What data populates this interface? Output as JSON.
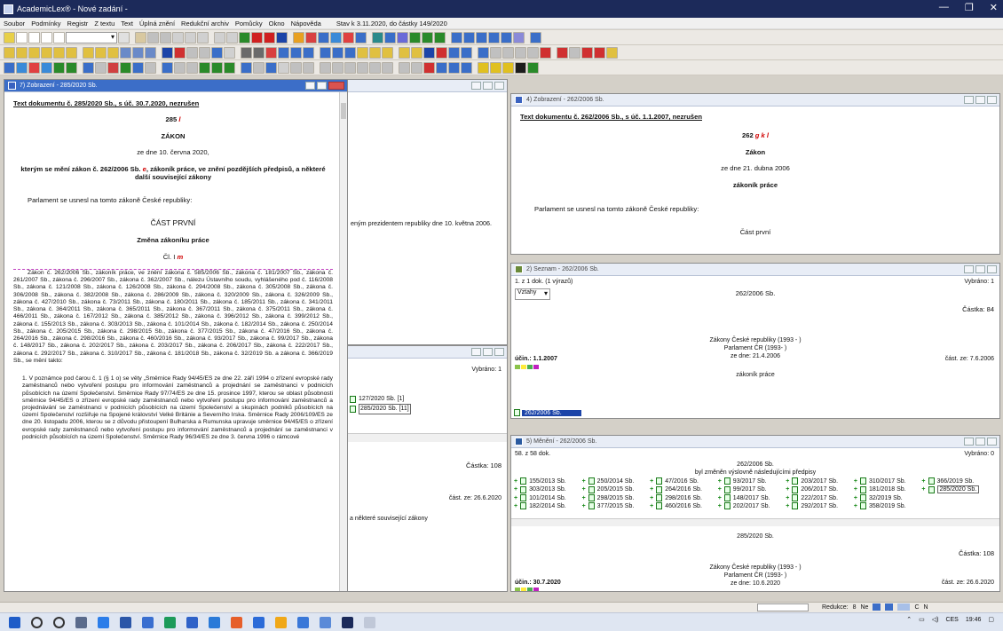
{
  "window": {
    "title": "AcademicLex® - Nové zadání -"
  },
  "menu": {
    "items": [
      "Soubor",
      "Podmínky",
      "Registr",
      "Z textu",
      "Text",
      "Úplná znění",
      "Redukční archiv",
      "Pomůcky",
      "Okno",
      "Nápověda"
    ],
    "status": "Stav k 3.11.2020, do částky 149/2020"
  },
  "win_left": {
    "title": "7) Zobrazení - 285/2020 Sb.",
    "heading": "Text dokumentu č. 285/2020 Sb., s úč. 30.7.2020, nezrušen",
    "number": "285",
    "number_suffix": "l",
    "type": "ZÁKON",
    "date": "ze dne 10. června 2020,",
    "subject_line1": "kterým se mění zákon č. 262/2006 Sb.",
    "subject_mark": "e",
    "subject_line2": ", zákoník práce, ve znění pozdějších předpisů, a některé",
    "subject_line3": "další související zákony",
    "preamble": "Parlament se usnesl na tomto zákoně České republiky:",
    "part": "ČÁST PRVNÍ",
    "part_title": "Změna zákoníku práce",
    "article": "Čl. I",
    "article_mark": "m",
    "para1": "Zákon č. 262/2006 Sb., zákoník práce, ve znění zákona č. 585/2006 Sb., zákona č. 181/2007 Sb., zákona č. 261/2007 Sb., zákona č. 296/2007 Sb., zákona č. 362/2007 Sb., nálezu Ústavního soudu, vyhlášeného pod č. 116/2008 Sb., zákona č. 121/2008 Sb., zákona č. 126/2008 Sb., zákona č. 294/2008 Sb., zákona č. 305/2008 Sb., zákona č. 306/2008 Sb., zákona č. 382/2008 Sb., zákona č. 286/2009 Sb., zákona č. 320/2009 Sb., zákona č. 326/2009 Sb., zákona č. 427/2010 Sb., zákona č. 73/2011 Sb., zákona č. 180/2011 Sb., zákona č. 185/2011 Sb., zákona č. 341/2011 Sb., zákona č. 364/2011 Sb., zákona č. 365/2011 Sb., zákona č. 367/2011 Sb., zákona č. 375/2011 Sb., zákona č. 466/2011 Sb., zákona č. 167/2012 Sb., zákona č. 385/2012 Sb., zákona č. 396/2012 Sb., zákona č. 399/2012 Sb., zákona č. 155/2013 Sb., zákona č. 303/2013 Sb., zákona č. 101/2014 Sb., zákona č. 182/2014 Sb., zákona č. 250/2014 Sb., zákona č. 205/2015 Sb., zákona č. 298/2015 Sb., zákona č. 377/2015 Sb., zákona č. 47/2016 Sb., zákona č. 264/2016 Sb., zákona č. 298/2016 Sb., zákona č. 460/2016 Sb., zákona č. 93/2017 Sb., zákona č. 99/2017 Sb., zákona č. 148/2017 Sb., zákona č. 202/2017 Sb., zákona č. 203/2017 Sb., zákona č. 206/2017 Sb., zákona č. 222/2017 Sb., zákona č. 292/2017 Sb., zákona č. 310/2017 Sb., zákona č. 181/2018 Sb., zákona č. 32/2019 Sb. a zákona č. 366/2019 Sb., se mění takto:",
    "para2": "1. V poznámce pod čarou č. 1 (§ 1 o) se věty „Směrnice Rady 94/45/ES ze dne 22. září 1994 o zřízení evropské rady zaměstnanců nebo vytvoření postupu pro informování zaměstnanců a projednání se zaměstnanci v podnicích působících na území Společenství. Směrnice Rady 97/74/ES ze dne 15. prosince 1997, kterou se oblast působnosti směrnice 94/45/ES o zřízení evropské rady zaměstnanců nebo vytvoření postupu pro informování zaměstnanců a projednávání se zaměstnanci v podnicích působících na území Společenství a skupinách podniků působících na území Společenství rozšiřuje na Spojené království Velké Británie a Severního Irska. Směrnice Rady 2006/109/ES ze dne 20. listopadu 2006, kterou se z důvodu přistoupení Bulharska a Rumunska upravuje směrnice 94/45/ES o zřízení evropské rady zaměstnanců nebo vytvoření postupu pro informování zaměstnanců a projednání se zaměstnanci v podnicích působících na území Společenství. Směrnice Rady 96/34/ES ze dne 3. června 1996 o rámcové"
  },
  "win_mid_top": {
    "text": "eným prezidentem republiky dne 10. května 2006."
  },
  "win_mid_bottom": {
    "selected": "Vybráno: 1",
    "items": [
      "127/2020 Sb. [1]",
      "285/2020 Sb. [11]"
    ],
    "castka": "Částka: 108",
    "cast": "část. ze: 26.6.2020",
    "related": "a některé související zákony"
  },
  "win_right_top": {
    "title": "4) Zobrazení - 262/2006 Sb.",
    "heading": "Text dokumentu č. 262/2006 Sb., s úč. 1.1.2007, nezrušen",
    "number": "262",
    "marks": "g k l",
    "type": "Zákon",
    "date": "ze dne 21. dubna 2006",
    "name": "zákoník práce",
    "preamble": "Parlament se usnesl na tomto zákoně České republiky:",
    "part": "Část první"
  },
  "win_seznam": {
    "title": "2) Seznam - 262/2006 Sb.",
    "count": "1. z 1 dok. (1 výrazů)",
    "selected": "Vybráno: 1",
    "combo": "Vztahy",
    "doc": "262/2006 Sb.",
    "castka": "Částka: 84",
    "issuer1": "Zákony České republiky (1993 -   )",
    "issuer2": "Parlament ČR (1993-   )",
    "ucinnost": "účin.: 1.1.2007",
    "date": "ze dne: 21.4.2006",
    "cast": "část. ze: 7.6.2006",
    "name": "zákoník práce",
    "list_item": "262/2006 Sb."
  },
  "win_meneni": {
    "title": "5) Měnění - 262/2006 Sb.",
    "count": "58. z 58 dok.",
    "selected": "Vybráno: 0",
    "doc": "262/2006 Sb.",
    "subtitle": "byl změněn výslovně následujícími předpisy",
    "grid": [
      "155/2013 Sb.",
      "250/2014 Sb.",
      "47/2016 Sb.",
      "93/2017 Sb.",
      "203/2017 Sb.",
      "310/2017 Sb.",
      "366/2019 Sb.",
      "303/2013 Sb.",
      "205/2015 Sb.",
      "264/2016 Sb.",
      "99/2017 Sb.",
      "206/2017 Sb.",
      "181/2018 Sb.",
      "285/2020 Sb.",
      "101/2014 Sb.",
      "298/2015 Sb.",
      "298/2016 Sb.",
      "148/2017 Sb.",
      "222/2017 Sb.",
      "32/2019 Sb.",
      "",
      "182/2014 Sb.",
      "377/2015 Sb.",
      "460/2016 Sb.",
      "202/2017 Sb.",
      "292/2017 Sb.",
      "358/2019 Sb.",
      ""
    ],
    "doc2": "285/2020 Sb.",
    "castka2": "Částka: 108",
    "issuer1": "Zákony České republiky (1993 -   )",
    "issuer2": "Parlament ČR (1993-   )",
    "ucinnost": "účin.: 30.7.2020",
    "date": "ze dne: 10.6.2020",
    "cast": "část. ze: 26.6.2020"
  },
  "statusbar": {
    "reduction": "Redukce:",
    "reduction_val": "8",
    "ne": "Ne",
    "lang": "C",
    "lang2": "N"
  },
  "taskbar": {
    "lang": "CES",
    "time": "19:46"
  },
  "colors": {
    "accent": "#3c6ec8",
    "red_mark": "#d00000",
    "green": "#1a8a1a",
    "selection": "#1c44a8"
  }
}
